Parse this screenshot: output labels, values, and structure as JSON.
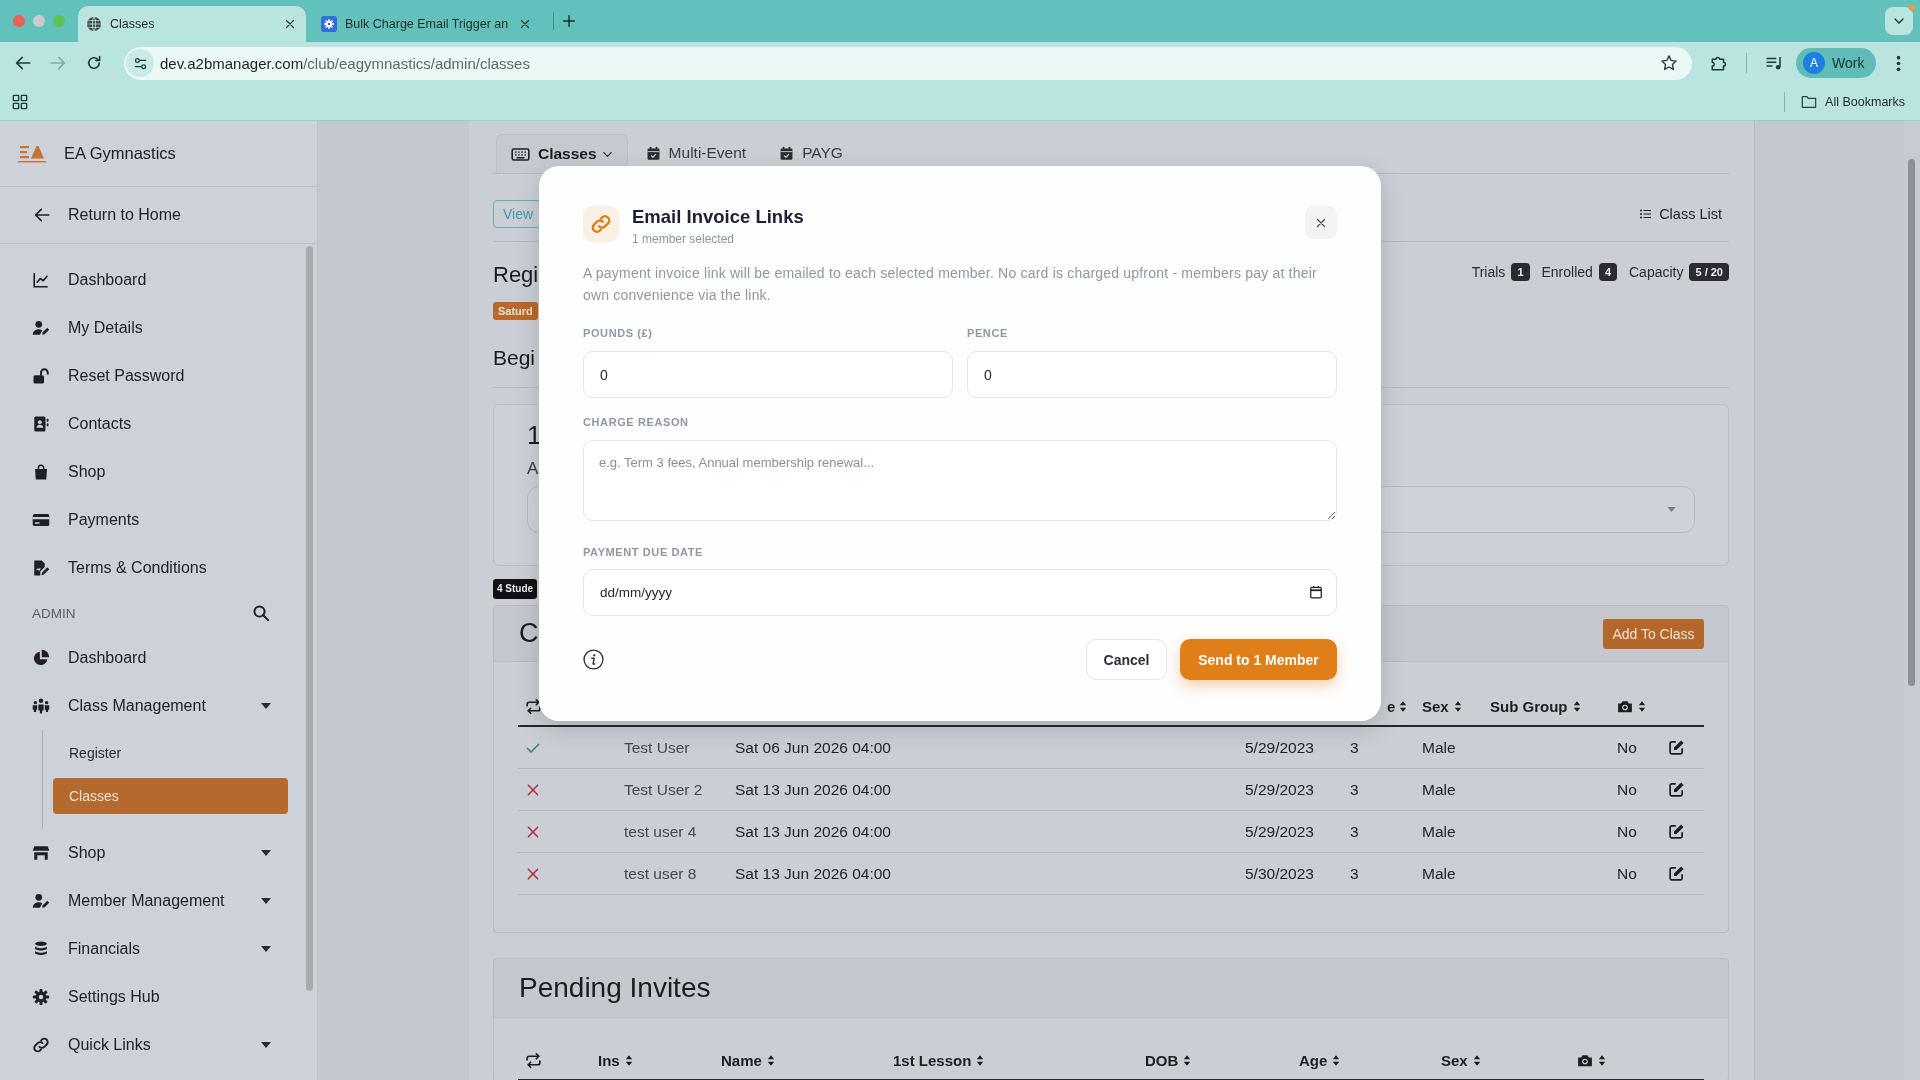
{
  "browser": {
    "tabs": [
      {
        "title": "Classes",
        "selected": true
      },
      {
        "title": "Bulk Charge Email Trigger an",
        "selected": false
      }
    ],
    "forward_disabled": true,
    "address": {
      "host": "dev.a2bmanager.com",
      "path": "/club/eagymnastics/admin/classes"
    },
    "profile": {
      "initial": "A",
      "name": "Work"
    },
    "bookmarks_button": "All Bookmarks"
  },
  "sidebar": {
    "brand": "EA Gymnastics",
    "return_link": "Return to Home",
    "items": [
      {
        "label": "Dashboard",
        "selected": false
      },
      {
        "label": "My Details",
        "selected": false
      },
      {
        "label": "Reset Password",
        "selected": false
      },
      {
        "label": "Contacts",
        "selected": false
      },
      {
        "label": "Shop",
        "selected": false
      },
      {
        "label": "Payments",
        "selected": false
      },
      {
        "label": "Terms & Conditions",
        "selected": false
      }
    ],
    "admin": {
      "heading": "ADMIN",
      "items": [
        {
          "label": "Dashboard",
          "selected": false,
          "has_submenu": false
        },
        {
          "label": "Class Management",
          "selected": false,
          "has_submenu": true,
          "children": [
            {
              "label": "Register",
              "selected": false
            },
            {
              "label": "Classes",
              "selected": true
            }
          ]
        },
        {
          "label": "Shop",
          "selected": false,
          "has_submenu": true
        },
        {
          "label": "Member Management",
          "selected": false,
          "has_submenu": true
        },
        {
          "label": "Financials",
          "selected": false,
          "has_submenu": true
        },
        {
          "label": "Settings Hub",
          "selected": false,
          "has_submenu": false
        },
        {
          "label": "Quick Links",
          "selected": false,
          "has_submenu": true
        }
      ]
    }
  },
  "main": {
    "view_tabs": [
      {
        "label": "Classes",
        "selected": true,
        "has_menu": true
      },
      {
        "label": "Multi-Event",
        "selected": false,
        "has_menu": false
      },
      {
        "label": "PAYG",
        "selected": false,
        "has_menu": false
      }
    ],
    "view_button": "View",
    "class_list_button": "Class List",
    "register": {
      "title": "Regi",
      "day_badge": "Saturd",
      "stats": [
        {
          "label": "Trials",
          "count": "1"
        },
        {
          "label": "Enrolled",
          "count": "4"
        },
        {
          "label": "Capacity",
          "count": "5 / 20"
        }
      ]
    },
    "subtitle": "Begi",
    "lesson": {
      "number": "1",
      "text": "A"
    },
    "students_badge": "4 Stude",
    "class_card": {
      "title": "C",
      "add_button": "Add To Class",
      "columns": [
        "e",
        "Sex",
        "Sub Group"
      ],
      "rows": [
        {
          "present": true,
          "name": "Test User",
          "first_lesson": "Sat 06 Jun 2026 04:00",
          "dob": "5/29/2023",
          "age": "3",
          "sex": "Male",
          "photo": "No"
        },
        {
          "present": false,
          "name": "Test User 2",
          "first_lesson": "Sat 13 Jun 2026 04:00",
          "dob": "5/29/2023",
          "age": "3",
          "sex": "Male",
          "photo": "No"
        },
        {
          "present": false,
          "name": "test user 4",
          "first_lesson": "Sat 13 Jun 2026 04:00",
          "dob": "5/29/2023",
          "age": "3",
          "sex": "Male",
          "photo": "No"
        },
        {
          "present": false,
          "name": "test user 8",
          "first_lesson": "Sat 13 Jun 2026 04:00",
          "dob": "5/30/2023",
          "age": "3",
          "sex": "Male",
          "photo": "No"
        }
      ]
    },
    "pending_invites": {
      "title": "Pending Invites",
      "columns": [
        "Ins",
        "Name",
        "1st Lesson",
        "DOB",
        "Age",
        "Sex"
      ]
    }
  },
  "dialog": {
    "title": "Email Invoice Links",
    "subtitle": "1 member selected",
    "description": "A payment invoice link will be emailed to each selected member. No card is charged upfront - members pay at their own convenience via the link.",
    "amount_fields": [
      {
        "label": "POUNDS (£)",
        "value": "0"
      },
      {
        "label": "PENCE",
        "value": "0"
      }
    ],
    "reason": {
      "label": "CHARGE REASON",
      "placeholder": "e.g. Term 3 fees, Annual membership renewal..."
    },
    "due_date": {
      "label": "PAYMENT DUE DATE",
      "placeholder": "dd/mm/yyyy"
    },
    "buttons": [
      {
        "label": "Cancel",
        "kind": "secondary"
      },
      {
        "label": "Send to 1 Member",
        "kind": "primary"
      }
    ]
  }
}
